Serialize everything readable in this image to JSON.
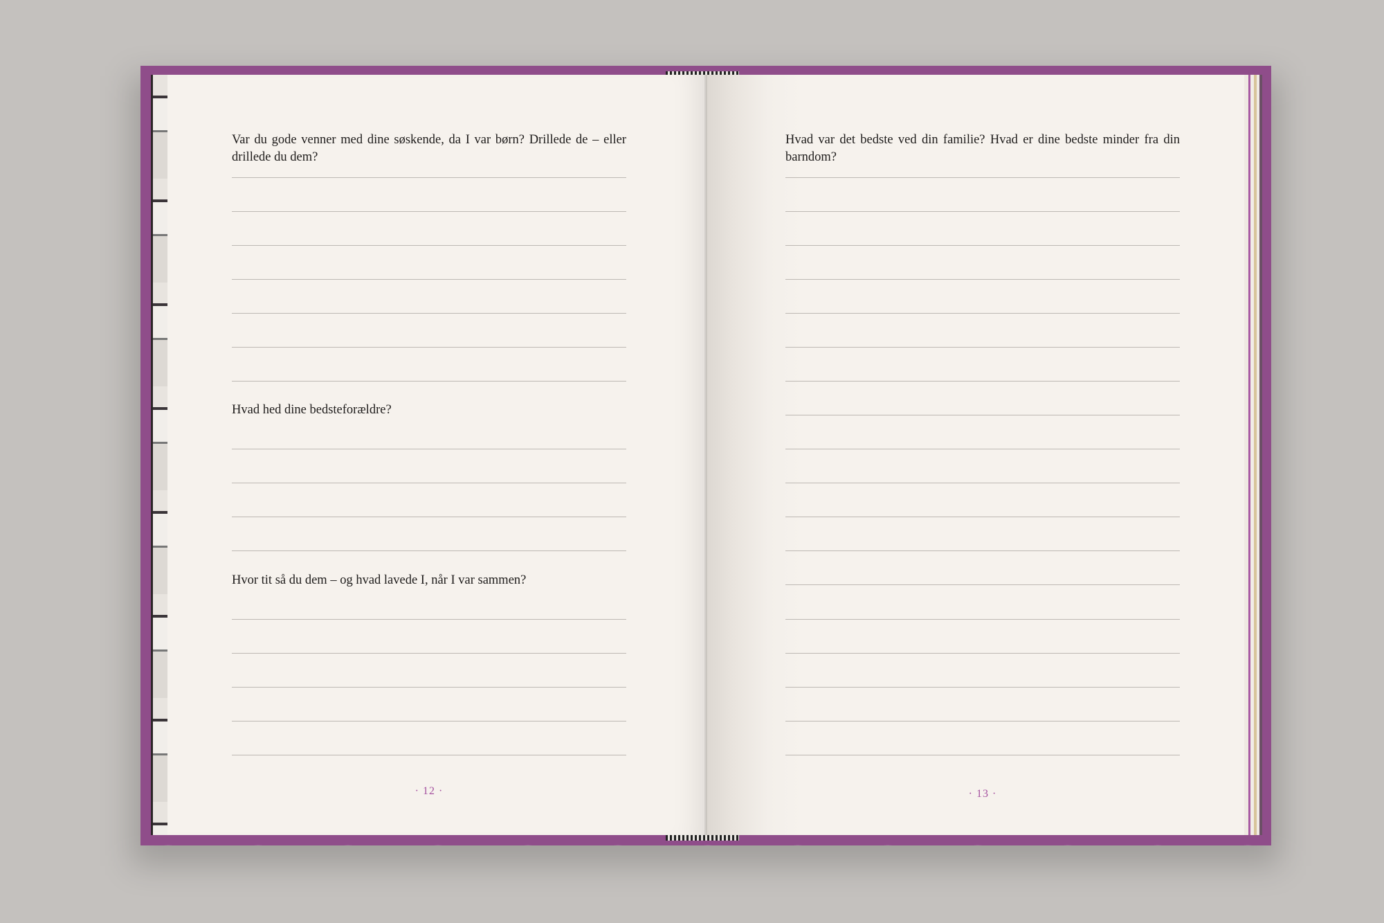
{
  "book": {
    "left_page": {
      "questions": [
        "Var du gode venner med dine søskende, da I var børn? Drillede de – eller drillede du dem?",
        "Hvad hed dine bedsteforældre?",
        "Hvor tit så du dem – og hvad lavede I, når I var sammen?"
      ],
      "page_number": "· 12 ·"
    },
    "right_page": {
      "questions": [
        "Hvad var det bedste ved din familie? Hvad er dine bedste minder fra din barndom?"
      ],
      "page_number": "· 13 ·"
    },
    "colors": {
      "cover": "#8f4d8a",
      "paper": "#f6f2ed",
      "page_number": "#a4509f",
      "rule": "#bdb8b3"
    }
  }
}
